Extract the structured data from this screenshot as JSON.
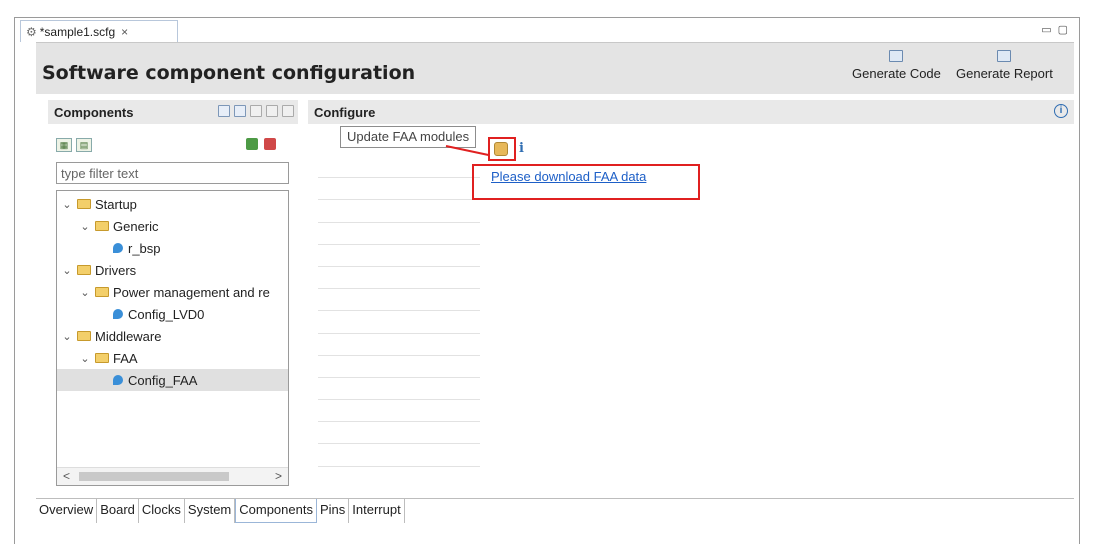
{
  "editor_tab": {
    "title": "*sample1.scfg",
    "close_glyph": "×"
  },
  "window_controls": {
    "minimize": "▭",
    "maximize": "▢"
  },
  "header": {
    "title": "Software component configuration",
    "generate_code": "Generate Code",
    "generate_report": "Generate Report"
  },
  "components": {
    "title": "Components",
    "filter_placeholder": "type filter text",
    "tree": [
      {
        "label": "Startup",
        "level": 0,
        "kind": "folder",
        "expanded": true
      },
      {
        "label": "Generic",
        "level": 1,
        "kind": "folder",
        "expanded": true
      },
      {
        "label": "r_bsp",
        "level": 2,
        "kind": "component"
      },
      {
        "label": "Drivers",
        "level": 0,
        "kind": "folder",
        "expanded": true
      },
      {
        "label": "Power management and re",
        "level": 1,
        "kind": "folder",
        "expanded": true
      },
      {
        "label": "Config_LVD0",
        "level": 2,
        "kind": "component"
      },
      {
        "label": "Middleware",
        "level": 0,
        "kind": "folder",
        "expanded": true
      },
      {
        "label": "FAA",
        "level": 1,
        "kind": "folder",
        "expanded": true
      },
      {
        "label": "Config_FAA",
        "level": 2,
        "kind": "component",
        "selected": true
      }
    ],
    "scroll_left": "<",
    "scroll_right": ">"
  },
  "configure": {
    "title": "Configure",
    "tooltip": "Update FAA modules",
    "info_glyph": "i",
    "info_circle_glyph": "i",
    "download_link": "Please download FAA data"
  },
  "bottom_tabs": [
    "Overview",
    "Board",
    "Clocks",
    "System",
    "Components",
    "Pins",
    "Interrupt"
  ],
  "active_bottom_tab": "Components",
  "colors": {
    "highlight_red": "#e02020",
    "link_blue": "#1d5fc7",
    "header_gray": "#e4e4e4"
  }
}
